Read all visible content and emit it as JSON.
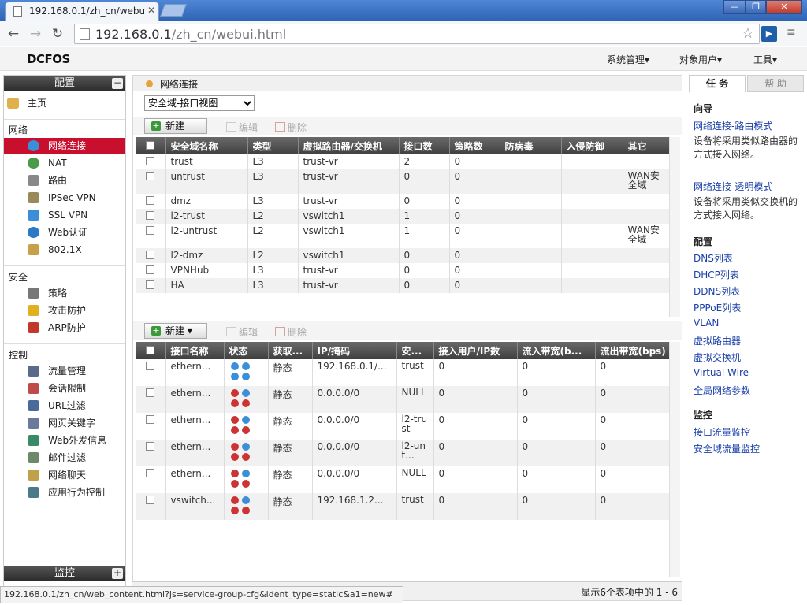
{
  "browser": {
    "tab_title": "192.168.0.1/zh_cn/webui",
    "url_host": "192.168.0.1",
    "url_path": "/zh_cn/webui.html",
    "status_url": "192.168.0.1/zh_cn/web_content.html?js=service-group-cfg&ident_type=static&a1=new#"
  },
  "header": {
    "logo": "DCFOS",
    "menus": [
      "系统管理",
      "对象用户",
      "工具"
    ]
  },
  "left": {
    "config_title": "配置",
    "home": "主页",
    "sections": [
      {
        "title": "网络",
        "items": [
          "网络连接",
          "NAT",
          "路由",
          "IPSec VPN",
          "SSL VPN",
          "Web认证",
          "802.1X"
        ]
      },
      {
        "title": "安全",
        "items": [
          "策略",
          "攻击防护",
          "ARP防护"
        ]
      },
      {
        "title": "控制",
        "items": [
          "流量管理",
          "会话限制",
          "URL过滤",
          "网页关键字",
          "Web外发信息",
          "邮件过滤",
          "网络聊天",
          "应用行为控制"
        ]
      }
    ],
    "monitor_title": "监控"
  },
  "main": {
    "breadcrumb": "网络连接",
    "view_select": "安全域-接口视图",
    "actions": {
      "new": "新建",
      "edit": "编辑",
      "delete": "删除"
    },
    "zones": {
      "headers": [
        "安全域名称",
        "类型",
        "虚拟路由器/交换机",
        "接口数",
        "策略数",
        "防病毒",
        "入侵防御",
        "其它"
      ],
      "rows": [
        [
          "trust",
          "L3",
          "trust-vr",
          "2",
          "0",
          "",
          "",
          ""
        ],
        [
          "untrust",
          "L3",
          "trust-vr",
          "0",
          "0",
          "",
          "",
          "WAN安全域"
        ],
        [
          "dmz",
          "L3",
          "trust-vr",
          "0",
          "0",
          "",
          "",
          ""
        ],
        [
          "l2-trust",
          "L2",
          "vswitch1",
          "1",
          "0",
          "",
          "",
          ""
        ],
        [
          "l2-untrust",
          "L2",
          "vswitch1",
          "1",
          "0",
          "",
          "",
          "WAN安全域"
        ],
        [
          "l2-dmz",
          "L2",
          "vswitch1",
          "0",
          "0",
          "",
          "",
          ""
        ],
        [
          "VPNHub",
          "L3",
          "trust-vr",
          "0",
          "0",
          "",
          "",
          ""
        ],
        [
          "HA",
          "L3",
          "trust-vr",
          "0",
          "0",
          "",
          "",
          ""
        ]
      ]
    },
    "interfaces": {
      "headers": [
        "接口名称",
        "状态",
        "获取...",
        "IP/掩码",
        "安...",
        "接入用户/IP数",
        "流入带宽(b...",
        "流出带宽(bps)"
      ],
      "rows": [
        [
          "ethern...",
          "静态",
          "192.168.0.1/...",
          "trust",
          "0",
          "0",
          "0"
        ],
        [
          "ethern...",
          "静态",
          "0.0.0.0/0",
          "NULL",
          "0",
          "0",
          "0"
        ],
        [
          "ethern...",
          "静态",
          "0.0.0.0/0",
          "l2-trust",
          "0",
          "0",
          "0"
        ],
        [
          "ethern...",
          "静态",
          "0.0.0.0/0",
          "l2-unt...",
          "0",
          "0",
          "0"
        ],
        [
          "ethern...",
          "静态",
          "0.0.0.0/0",
          "NULL",
          "0",
          "0",
          "0"
        ],
        [
          "vswitch...",
          "静态",
          "192.168.1.2...",
          "trust",
          "0",
          "0",
          "0"
        ]
      ]
    },
    "paging": "显示6个表项中的 1 - 6"
  },
  "right": {
    "tabs": [
      "任 务",
      "帮 助"
    ],
    "wizard_title": "向导",
    "wizards": [
      {
        "link": "网络连接-路由模式",
        "desc": "设备将采用类似路由器的方式接入网络。"
      },
      {
        "link": "网络连接-透明模式",
        "desc": "设备将采用类似交换机的方式接入网络。"
      }
    ],
    "config_title": "配置",
    "config_links": [
      "DNS列表",
      "DHCP列表",
      "DDNS列表",
      "PPPoE列表",
      "VLAN",
      "虚拟路由器",
      "虚拟交换机",
      "Virtual-Wire",
      "全局网络参数"
    ],
    "monitor_title": "监控",
    "monitor_links": [
      "接口流量监控",
      "安全域流量监控"
    ]
  }
}
